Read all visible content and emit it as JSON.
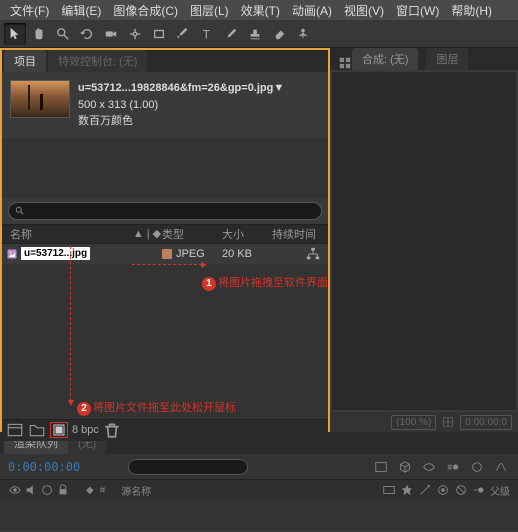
{
  "menu": {
    "file": "文件(F)",
    "edit": "编辑(E)",
    "composition": "图像合成(C)",
    "layer": "图层(L)",
    "effect": "效果(T)",
    "animation": "动画(A)",
    "view": "视图(V)",
    "window": "窗口(W)",
    "help": "帮助(H)"
  },
  "panels": {
    "project": "项目",
    "effect_controls": "特效控制台: (无)",
    "composition": "合成: (无)",
    "layer": "图层"
  },
  "asset": {
    "filename": "u=53712...19828846&fm=26&gp=0.jpg▼",
    "dimensions": "500 x 313 (1.00)",
    "color_mode": "数百万颜色",
    "short_name": "u=53712...jpg",
    "type": "JPEG",
    "size": "20 KB"
  },
  "columns": {
    "name": "名称",
    "type": "类型",
    "size": "大小",
    "duration": "持续时间"
  },
  "callouts": {
    "c1": "将图片拖拽至软件界面",
    "c2": "将图片文件拖至此处松开鼠标"
  },
  "footer": {
    "bpc": "8 bpc",
    "zoom": "(100 %)",
    "timecode": "0:00:00:0"
  },
  "timeline": {
    "render_queue": "渲染队列",
    "none": "(无)",
    "time": "0:00:00:00",
    "hash_label": "#",
    "source_name": "源名称",
    "parent": "父级"
  }
}
